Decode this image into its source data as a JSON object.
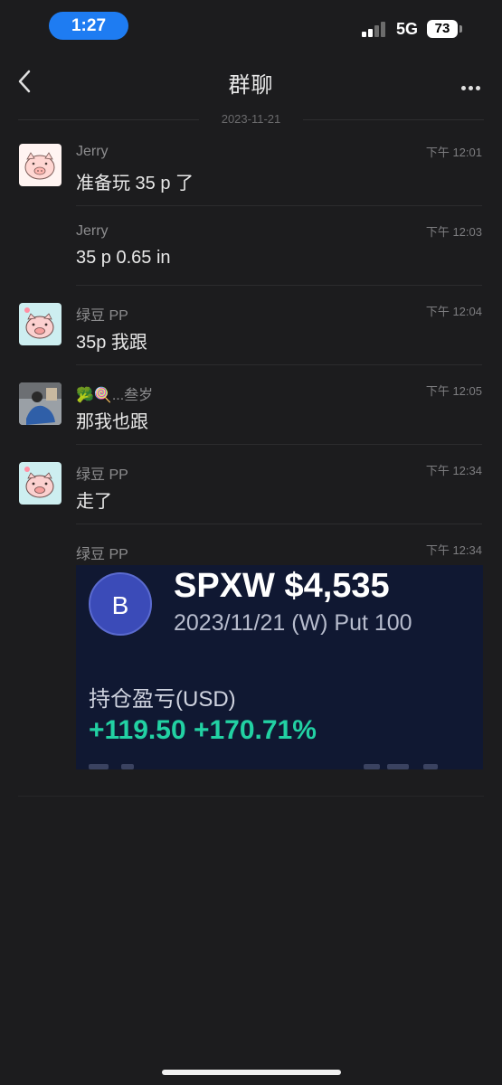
{
  "status": {
    "time": "1:27",
    "network": "5G",
    "battery": "73"
  },
  "nav": {
    "title": "群聊"
  },
  "date_separator": "2023-11-21",
  "messages": [
    {
      "sender": "Jerry",
      "time": "下午 12:01",
      "text": "准备玩 35 p 了",
      "avatar": "pig-sticker"
    },
    {
      "sender": "Jerry",
      "time": "下午 12:03",
      "text": "35 p 0.65 in"
    },
    {
      "sender": "绿豆 PP",
      "time": "下午 12:04",
      "text": "35p 我跟",
      "avatar": "pig-cartoon"
    },
    {
      "sender": "🥦🍭...叁岁",
      "time": "下午 12:05",
      "text": "那我也跟",
      "avatar": "photo"
    },
    {
      "sender": "绿豆 PP",
      "time": "下午 12:34",
      "text": "走了",
      "avatar": "pig-cartoon"
    },
    {
      "sender": "绿豆 PP",
      "time": "下午 12:34"
    }
  ],
  "card": {
    "logo_letter": "B",
    "symbol": "SPXW $4,535",
    "subtitle": "2023/11/21 (W) Put 100",
    "pnl_label": "持仓盈亏(USD)",
    "pnl_value": "+119.50 +170.71%"
  },
  "colors": {
    "accent": "#1e7cf2",
    "profit": "#22d1a3",
    "card_bg": "#101832"
  }
}
